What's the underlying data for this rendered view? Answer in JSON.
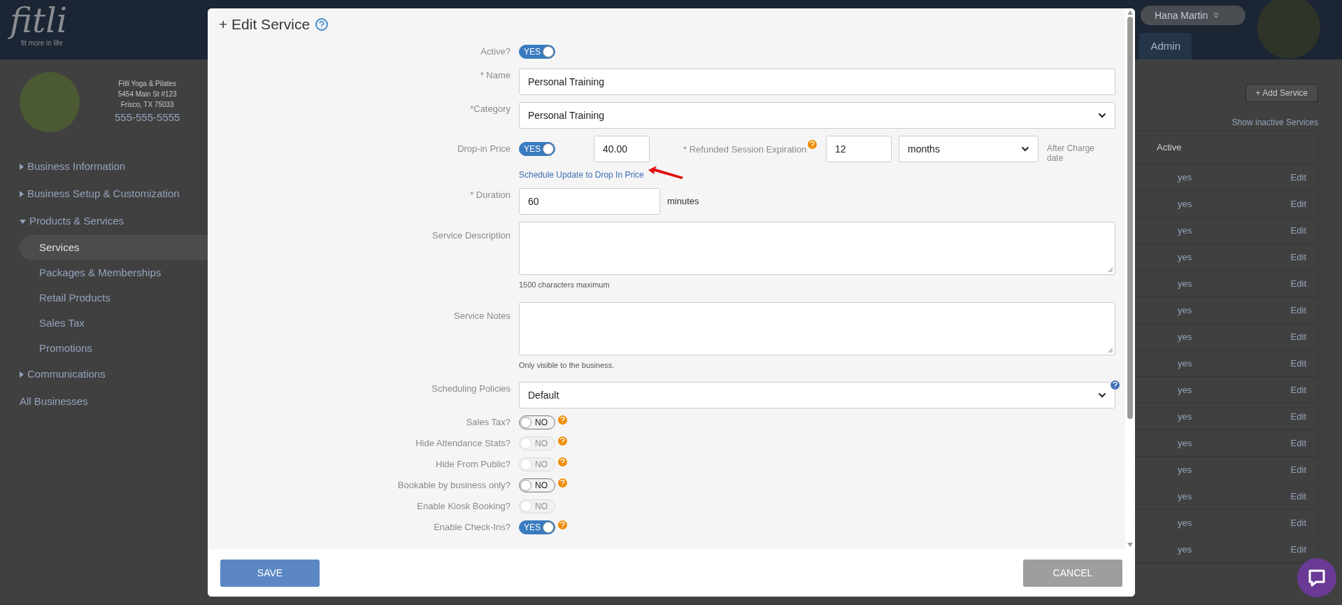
{
  "header": {
    "logo": "fitli",
    "tagline": "fit more in life",
    "user": "Hana Martin",
    "tab": "Admin"
  },
  "business": {
    "name": "Fitli Yoga & Pilates",
    "address": "5454 Main St #123",
    "city": "Frisco, TX 75033",
    "phone": "555-555-5555"
  },
  "sidebar": {
    "items": [
      {
        "label": "Business Information",
        "expanded": false
      },
      {
        "label": "Business Setup & Customization",
        "expanded": false
      },
      {
        "label": "Products & Services",
        "expanded": true,
        "children": [
          {
            "label": "Services",
            "selected": true
          },
          {
            "label": "Packages & Memberships",
            "selected": false
          },
          {
            "label": "Retail Products",
            "selected": false
          },
          {
            "label": "Sales Tax",
            "selected": false
          },
          {
            "label": "Promotions",
            "selected": false
          }
        ]
      },
      {
        "label": "Communications",
        "expanded": false
      },
      {
        "label": "All Businesses"
      }
    ]
  },
  "main": {
    "add_button": "+ Add Service",
    "inactive_link": "Show inactive Services",
    "table": {
      "columns": [
        "Active"
      ],
      "rows": [
        {
          "active": "yes",
          "action": "Edit"
        },
        {
          "active": "yes",
          "action": "Edit"
        },
        {
          "active": "yes",
          "action": "Edit"
        },
        {
          "active": "yes",
          "action": "Edit"
        },
        {
          "active": "yes",
          "action": "Edit"
        },
        {
          "active": "yes",
          "action": "Edit"
        },
        {
          "active": "yes",
          "action": "Edit"
        },
        {
          "active": "yes",
          "action": "Edit"
        },
        {
          "active": "yes",
          "action": "Edit"
        },
        {
          "active": "yes",
          "action": "Edit"
        },
        {
          "active": "yes",
          "action": "Edit"
        },
        {
          "active": "yes",
          "action": "Edit"
        },
        {
          "active": "yes",
          "action": "Edit"
        },
        {
          "active": "yes",
          "action": "Edit"
        },
        {
          "active": "yes",
          "action": "Edit"
        }
      ]
    }
  },
  "modal": {
    "title": "+ Edit Service",
    "fields": [
      {
        "kind": "toggle",
        "label": "Active?",
        "on": true,
        "disabled": false,
        "text": "YES",
        "help": false
      },
      {
        "kind": "text",
        "label": "* Name",
        "value": "Personal Training"
      },
      {
        "kind": "select",
        "label": "*Category",
        "value": "Personal Training",
        "help": false
      },
      {
        "kind": "price",
        "label": "Drop-in Price",
        "on": true,
        "text": "YES",
        "value": "40.00",
        "expiration_label": "* Refunded Session Expiration",
        "expiration_value": "12",
        "unit": "months",
        "note": "After Charge date",
        "link": "Schedule Update to Drop In Price"
      },
      {
        "kind": "duration",
        "label": "* Duration",
        "value": "60",
        "unit": "minutes"
      },
      {
        "kind": "textarea",
        "label": "Service Description",
        "hint": "1500 characters maximum"
      },
      {
        "kind": "textarea",
        "label": "Service Notes",
        "hint": "Only visible to the business."
      },
      {
        "kind": "select",
        "label": "Scheduling Policies",
        "value": "Default",
        "help": true
      },
      {
        "kind": "toggle",
        "label": "Sales Tax?",
        "on": false,
        "disabled": false,
        "text": "NO",
        "help": true
      },
      {
        "kind": "toggle",
        "label": "Hide Attendance Stats?",
        "on": false,
        "disabled": true,
        "text": "NO",
        "help": true
      },
      {
        "kind": "toggle",
        "label": "Hide From Public?",
        "on": false,
        "disabled": true,
        "text": "NO",
        "help": true
      },
      {
        "kind": "toggle",
        "label": "Bookable by business only?",
        "on": false,
        "disabled": false,
        "text": "NO",
        "help": true
      },
      {
        "kind": "toggle",
        "label": "Enable Kiosk Booking?",
        "on": false,
        "disabled": true,
        "text": "NO",
        "help": false
      },
      {
        "kind": "toggle",
        "label": "Enable Check-Ins?",
        "on": true,
        "disabled": false,
        "text": "YES",
        "help": true
      }
    ],
    "save": "SAVE",
    "cancel": "CANCEL"
  }
}
